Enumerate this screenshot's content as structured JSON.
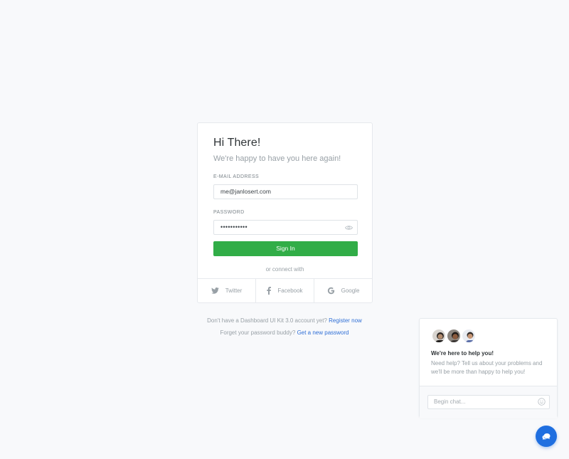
{
  "login": {
    "title": "Hi There!",
    "subtitle": "We're happy to have you here again!",
    "email_label": "E-MAIL ADDRESS",
    "email_value": "me@janlosert.com",
    "password_label": "PASSWORD",
    "password_value": "•••••••••••",
    "signin_label": "Sign In",
    "or_connect": "or connect with",
    "social": [
      {
        "label": "Twitter",
        "icon": "twitter-icon"
      },
      {
        "label": "Facebook",
        "icon": "facebook-icon"
      },
      {
        "label": "Google",
        "icon": "google-icon"
      }
    ]
  },
  "footer": {
    "register_text": "Don't have a Dashboard UI Kit 3.0 account yet?",
    "register_link": "Register now",
    "forgot_text": "Forget your password buddy?",
    "forgot_link": "Get a new password"
  },
  "chat": {
    "title": "We're here to help you!",
    "text": "Need help? Tell us about your problems and we'll be more than happy to help you!",
    "input_placeholder": "Begin chat...",
    "avatars": [
      "avatar-1",
      "avatar-2",
      "avatar-3"
    ]
  },
  "colors": {
    "accent_green": "#31ad47",
    "link_blue": "#2f6fd6",
    "fab_blue": "#1f6fe0",
    "background": "#f8f9fb"
  }
}
